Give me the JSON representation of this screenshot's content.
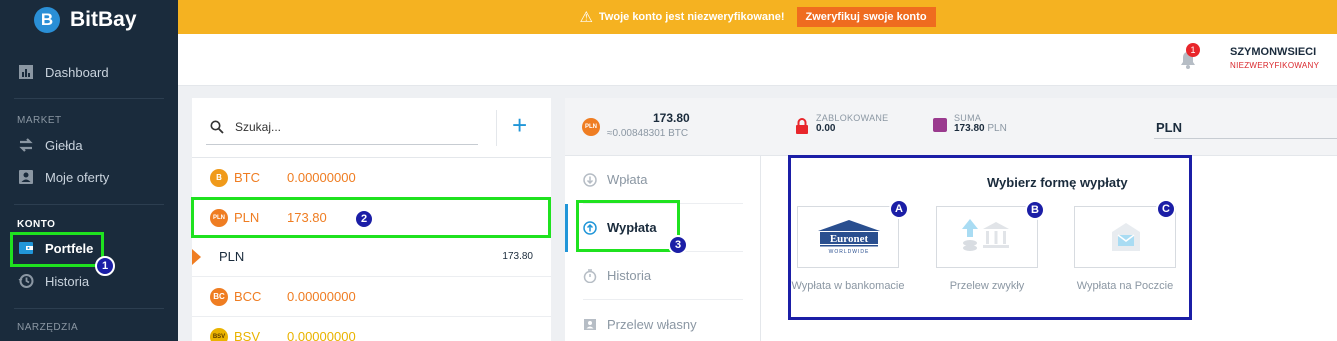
{
  "brand": {
    "name": "BitBay"
  },
  "sidebar": {
    "dashboard": "Dashboard",
    "market_label": "MARKET",
    "gielda": "Giełda",
    "moje_oferty": "Moje oferty",
    "konto_label": "KONTO",
    "portfele": "Portfele",
    "historia": "Historia",
    "narzedzia_label": "NARZĘDZIA"
  },
  "banner": {
    "message": "Twoje konto jest niezweryfikowane!",
    "verify_button": "Zweryfikuj swoje konto"
  },
  "header": {
    "notification_count": "1",
    "username": "SZYMONWSIECI",
    "status": "NIEZWERYFIKOWANY"
  },
  "wallets": {
    "search_placeholder": "Szukaj...",
    "add_icon": "plus-icon",
    "rows": [
      {
        "symbol": "BTC",
        "balance": "0.00000000",
        "color": "#f09a1a",
        "icon": "B"
      },
      {
        "symbol": "PLN",
        "balance": "173.80",
        "color": "#ef7d22",
        "icon": "PLN"
      },
      {
        "symbol": "BCC",
        "balance": "0.00000000",
        "color": "#ef7d22",
        "icon": "BC"
      },
      {
        "symbol": "BSV",
        "balance": "0.00000000",
        "color": "#eab300",
        "icon": "BSV"
      }
    ],
    "sub_wallet": {
      "name": "PLN",
      "value": "173.80"
    }
  },
  "detail": {
    "currency_icon": "PLN",
    "amount": "173.80",
    "btc_equiv": "≈0.00848301",
    "btc_unit": "BTC",
    "blocked_label": "ZABLOKOWANE",
    "blocked_value": "0.00",
    "sum_label": "SUMA",
    "sum_value": "173.80",
    "sum_unit": "PLN",
    "currency": "PLN"
  },
  "tabs": [
    "Wpłata",
    "Wypłata",
    "Historia",
    "Przelew własny"
  ],
  "withdraw": {
    "title": "Wybierz formę wypłaty",
    "methods": [
      {
        "label": "Wypłata w bankomacie",
        "logo_text": "Euronet",
        "logo_sub": "WORLDWIDE"
      },
      {
        "label": "Przelew zwykły"
      },
      {
        "label": "Wypłata na Poczcie"
      }
    ]
  },
  "markers": [
    "1",
    "2",
    "3",
    "A",
    "B",
    "C"
  ],
  "colors": {
    "sidebar": "#1a2b3c",
    "banner": "#f5b221",
    "accent": "#ef7d22",
    "blue": "#2196d8",
    "highlight_green": "#1fe21f",
    "highlight_blue": "#1b1ea6"
  }
}
